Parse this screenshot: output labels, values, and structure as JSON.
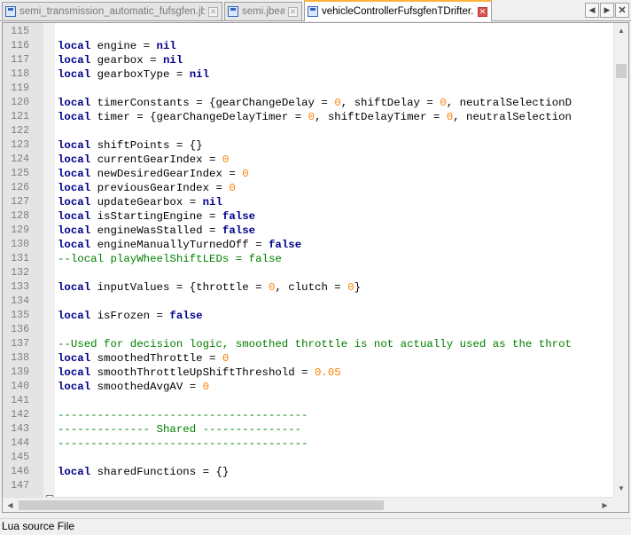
{
  "tabs": [
    {
      "label": "semi_transmission_automatic_fufsgfen.jbeam",
      "active": false
    },
    {
      "label": "semi.jbeam",
      "active": false
    },
    {
      "label": "vehicleControllerFufsgfenTDrifter.lua",
      "active": true
    }
  ],
  "tab_nav": {
    "prev_icon": "chevron-left-icon",
    "next_icon": "chevron-right-icon",
    "close_icon": "close-icon"
  },
  "code_lines": [
    {
      "n": "115",
      "tokens": []
    },
    {
      "n": "116",
      "tokens": [
        {
          "t": "kw",
          "v": "local"
        },
        {
          "t": "p",
          "v": " engine = "
        },
        {
          "t": "kw",
          "v": "nil"
        }
      ]
    },
    {
      "n": "117",
      "tokens": [
        {
          "t": "kw",
          "v": "local"
        },
        {
          "t": "p",
          "v": " gearbox = "
        },
        {
          "t": "kw",
          "v": "nil"
        }
      ]
    },
    {
      "n": "118",
      "tokens": [
        {
          "t": "kw",
          "v": "local"
        },
        {
          "t": "p",
          "v": " gearboxType = "
        },
        {
          "t": "kw",
          "v": "nil"
        }
      ]
    },
    {
      "n": "119",
      "tokens": []
    },
    {
      "n": "120",
      "tokens": [
        {
          "t": "kw",
          "v": "local"
        },
        {
          "t": "p",
          "v": " timerConstants = {gearChangeDelay = "
        },
        {
          "t": "num",
          "v": "0"
        },
        {
          "t": "p",
          "v": ", shiftDelay = "
        },
        {
          "t": "num",
          "v": "0"
        },
        {
          "t": "p",
          "v": ", neutralSelectionD"
        }
      ]
    },
    {
      "n": "121",
      "tokens": [
        {
          "t": "kw",
          "v": "local"
        },
        {
          "t": "p",
          "v": " timer = {gearChangeDelayTimer = "
        },
        {
          "t": "num",
          "v": "0"
        },
        {
          "t": "p",
          "v": ", shiftDelayTimer = "
        },
        {
          "t": "num",
          "v": "0"
        },
        {
          "t": "p",
          "v": ", neutralSelection"
        }
      ]
    },
    {
      "n": "122",
      "tokens": []
    },
    {
      "n": "123",
      "tokens": [
        {
          "t": "kw",
          "v": "local"
        },
        {
          "t": "p",
          "v": " shiftPoints = {}"
        }
      ]
    },
    {
      "n": "124",
      "tokens": [
        {
          "t": "kw",
          "v": "local"
        },
        {
          "t": "p",
          "v": " currentGearIndex = "
        },
        {
          "t": "num",
          "v": "0"
        }
      ]
    },
    {
      "n": "125",
      "tokens": [
        {
          "t": "kw",
          "v": "local"
        },
        {
          "t": "p",
          "v": " newDesiredGearIndex = "
        },
        {
          "t": "num",
          "v": "0"
        }
      ]
    },
    {
      "n": "126",
      "tokens": [
        {
          "t": "kw",
          "v": "local"
        },
        {
          "t": "p",
          "v": " previousGearIndex = "
        },
        {
          "t": "num",
          "v": "0"
        }
      ]
    },
    {
      "n": "127",
      "tokens": [
        {
          "t": "kw",
          "v": "local"
        },
        {
          "t": "p",
          "v": " updateGearbox = "
        },
        {
          "t": "kw",
          "v": "nil"
        }
      ]
    },
    {
      "n": "128",
      "tokens": [
        {
          "t": "kw",
          "v": "local"
        },
        {
          "t": "p",
          "v": " isStartingEngine = "
        },
        {
          "t": "kw",
          "v": "false"
        }
      ]
    },
    {
      "n": "129",
      "tokens": [
        {
          "t": "kw",
          "v": "local"
        },
        {
          "t": "p",
          "v": " engineWasStalled = "
        },
        {
          "t": "kw",
          "v": "false"
        }
      ]
    },
    {
      "n": "130",
      "tokens": [
        {
          "t": "kw",
          "v": "local"
        },
        {
          "t": "p",
          "v": " engineManuallyTurnedOff = "
        },
        {
          "t": "kw",
          "v": "false"
        }
      ]
    },
    {
      "n": "131",
      "tokens": [
        {
          "t": "cmt",
          "v": "--local playWheelShiftLEDs = false"
        }
      ]
    },
    {
      "n": "132",
      "tokens": []
    },
    {
      "n": "133",
      "tokens": [
        {
          "t": "kw",
          "v": "local"
        },
        {
          "t": "p",
          "v": " inputValues = {throttle = "
        },
        {
          "t": "num",
          "v": "0"
        },
        {
          "t": "p",
          "v": ", clutch = "
        },
        {
          "t": "num",
          "v": "0"
        },
        {
          "t": "p",
          "v": "}"
        }
      ]
    },
    {
      "n": "134",
      "tokens": []
    },
    {
      "n": "135",
      "tokens": [
        {
          "t": "kw",
          "v": "local"
        },
        {
          "t": "p",
          "v": " isFrozen = "
        },
        {
          "t": "kw",
          "v": "false"
        }
      ]
    },
    {
      "n": "136",
      "tokens": []
    },
    {
      "n": "137",
      "tokens": [
        {
          "t": "cmt",
          "v": "--Used for decision logic, smoothed throttle is not actually used as the throt"
        }
      ]
    },
    {
      "n": "138",
      "tokens": [
        {
          "t": "kw",
          "v": "local"
        },
        {
          "t": "p",
          "v": " smoothedThrottle = "
        },
        {
          "t": "num",
          "v": "0"
        }
      ]
    },
    {
      "n": "139",
      "tokens": [
        {
          "t": "kw",
          "v": "local"
        },
        {
          "t": "p",
          "v": " smoothThrottleUpShiftThreshold = "
        },
        {
          "t": "num",
          "v": "0.05"
        }
      ]
    },
    {
      "n": "140",
      "tokens": [
        {
          "t": "kw",
          "v": "local"
        },
        {
          "t": "p",
          "v": " smoothedAvgAV = "
        },
        {
          "t": "num",
          "v": "0"
        }
      ]
    },
    {
      "n": "141",
      "tokens": []
    },
    {
      "n": "142",
      "tokens": [
        {
          "t": "cmt",
          "v": "--------------------------------------"
        }
      ]
    },
    {
      "n": "143",
      "tokens": [
        {
          "t": "cmt",
          "v": "-------------- Shared ---------------"
        }
      ]
    },
    {
      "n": "144",
      "tokens": [
        {
          "t": "cmt",
          "v": "--------------------------------------"
        }
      ]
    },
    {
      "n": "145",
      "tokens": []
    },
    {
      "n": "146",
      "tokens": [
        {
          "t": "kw",
          "v": "local"
        },
        {
          "t": "p",
          "v": " sharedFunctions = {}"
        }
      ]
    },
    {
      "n": "147",
      "tokens": []
    }
  ],
  "colors": {
    "keyword": "#00008b",
    "number": "#ff8000",
    "comment": "#008000",
    "active_tab_accent": "#ffb33c"
  },
  "status": {
    "file_type": "Lua source File"
  }
}
